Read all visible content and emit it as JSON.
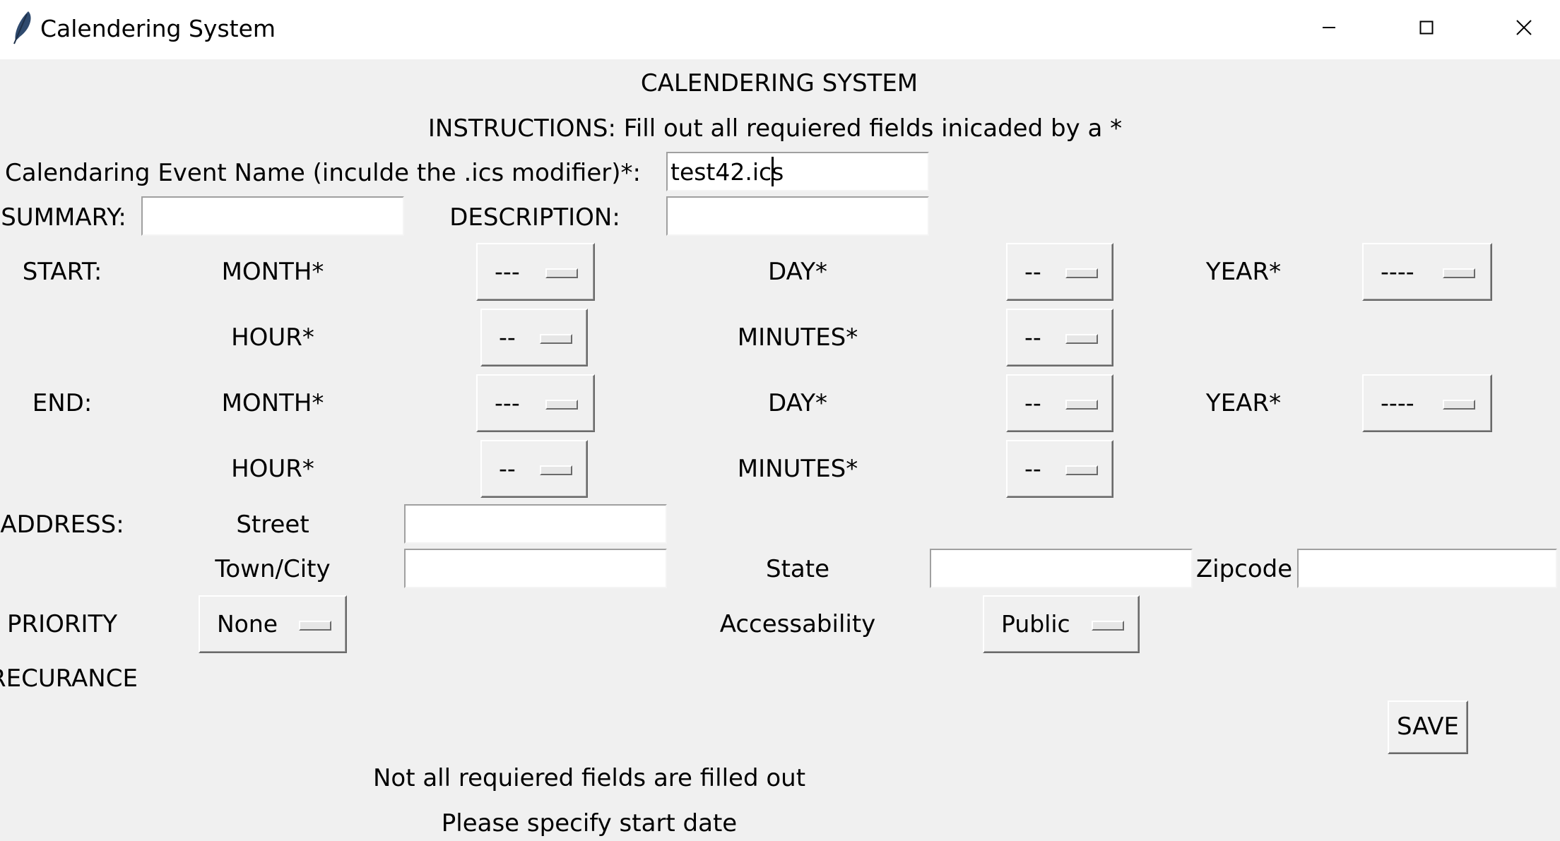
{
  "window": {
    "title": "Calendering System",
    "icons": {
      "app": "feather-icon",
      "minimize": "minimize-icon",
      "maximize": "maximize-icon",
      "close": "close-icon"
    }
  },
  "header": {
    "heading": "CALENDERING SYSTEM",
    "instructions": "INSTRUCTIONS: Fill out all requiered fields inicaded by a *"
  },
  "event_name": {
    "label": "Calendaring Event Name (inculde the .ics modifier)*:",
    "value": "test42.ics"
  },
  "summary": {
    "label": "SUMMARY:",
    "value": ""
  },
  "description": {
    "label": "DESCRIPTION:",
    "value": ""
  },
  "start": {
    "label": "START:",
    "month_label": "MONTH*",
    "month_value": "---",
    "day_label": "DAY*",
    "day_value": "--",
    "year_label": "YEAR*",
    "year_value": "----",
    "hour_label": "HOUR*",
    "hour_value": "--",
    "minutes_label": "MINUTES*",
    "minutes_value": "--"
  },
  "end": {
    "label": "END:",
    "month_label": "MONTH*",
    "month_value": "---",
    "day_label": "DAY*",
    "day_value": "--",
    "year_label": "YEAR*",
    "year_value": "----",
    "hour_label": "HOUR*",
    "hour_value": "--",
    "minutes_label": "MINUTES*",
    "minutes_value": "--"
  },
  "address": {
    "label": "ADDRESS:",
    "street_label": "Street",
    "street_value": "",
    "town_label": "Town/City",
    "town_value": "",
    "state_label": "State",
    "state_value": "",
    "zip_label": "Zipcode",
    "zip_value": ""
  },
  "priority": {
    "label": "PRIORITY",
    "value": "None"
  },
  "accessability": {
    "label": "Accessability",
    "value": "Public"
  },
  "recurrence": {
    "label": "RECURANCE"
  },
  "save_button": "SAVE",
  "status": {
    "line1": "Not all requiered fields are filled out",
    "line2": "Please specify start date"
  }
}
